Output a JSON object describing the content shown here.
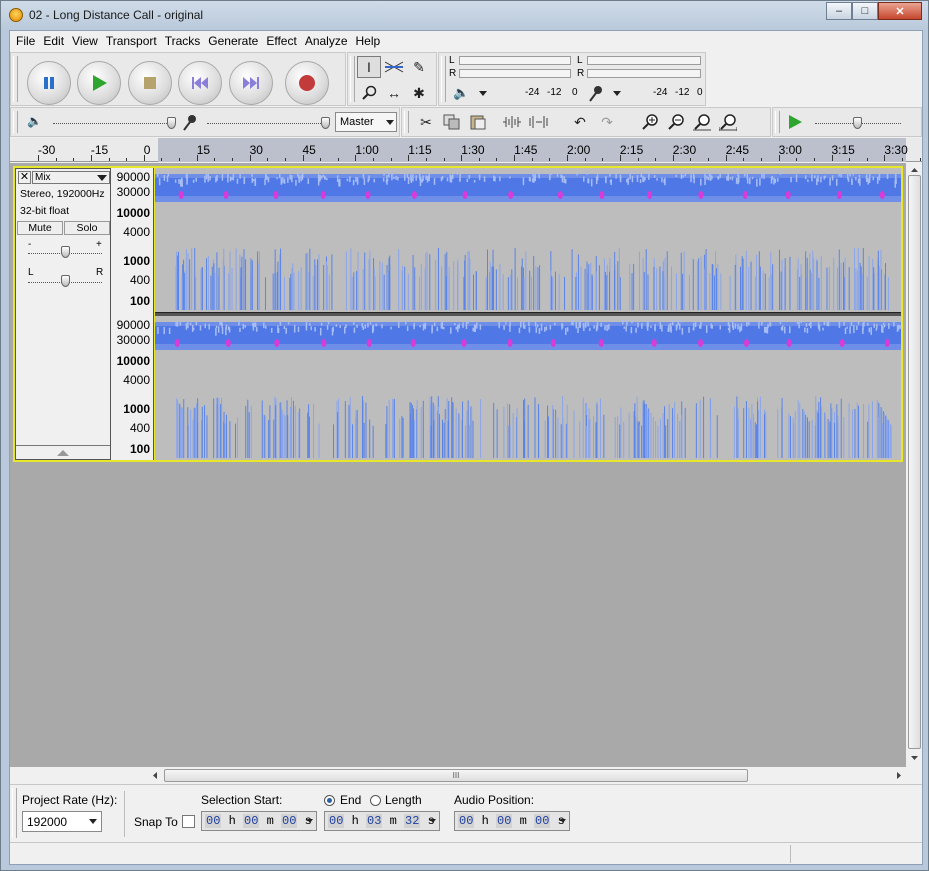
{
  "window": {
    "title": "02 - Long Distance Call - original",
    "min": "‒",
    "max": "□",
    "close": "✕"
  },
  "menu": [
    "File",
    "Edit",
    "View",
    "Transport",
    "Tracks",
    "Generate",
    "Effect",
    "Analyze",
    "Help"
  ],
  "meters": {
    "left": "L",
    "right": "R",
    "play_ticks": [
      "-24",
      "-12",
      "0"
    ],
    "rec_ticks": [
      "-24",
      "-12",
      "0"
    ]
  },
  "mixer": {
    "source": "Master"
  },
  "ruler": {
    "labels": [
      "-30",
      "-15",
      "0",
      "15",
      "30",
      "45",
      "1:00",
      "1:15",
      "1:30",
      "1:45",
      "2:00",
      "2:15",
      "2:30",
      "2:45",
      "3:00",
      "3:15",
      "3:30"
    ]
  },
  "track": {
    "name": "Mix",
    "info1": "Stereo, 192000Hz",
    "info2": "32-bit float",
    "mute": "Mute",
    "solo": "Solo",
    "gain_minus": "-",
    "gain_plus": "+",
    "pan_l": "L",
    "pan_r": "R",
    "freq_labels": [
      "90000",
      "30000",
      "10000",
      "4000",
      "1000",
      "400",
      "100"
    ]
  },
  "selection": {
    "project_rate_label": "Project Rate (Hz):",
    "project_rate_value": "192000",
    "snap_to_label": "Snap To",
    "selection_start_label": "Selection Start:",
    "end_label": "End",
    "length_label": "Length",
    "audio_position_label": "Audio Position:",
    "start_time": {
      "h": "00",
      "m": "00",
      "s": "00"
    },
    "end_time": {
      "h": "00",
      "m": "03",
      "s": "32"
    },
    "audio_time": {
      "h": "00",
      "m": "00",
      "s": "00"
    },
    "unit_h": "h",
    "unit_m": "m",
    "unit_s": "s"
  },
  "scroll": {
    "grip": "III"
  }
}
